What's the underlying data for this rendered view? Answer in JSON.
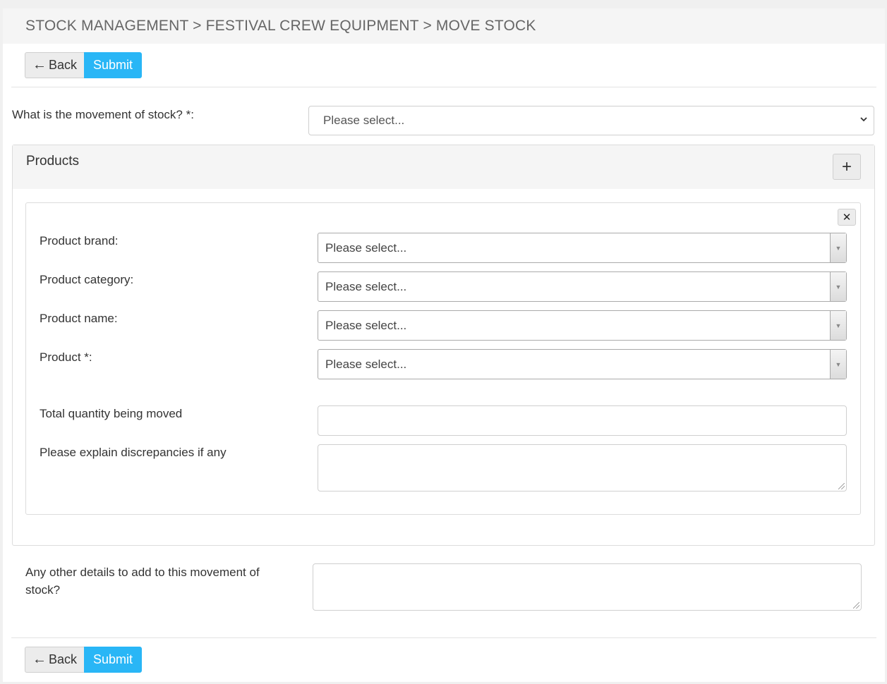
{
  "breadcrumb": "STOCK MANAGEMENT > FESTIVAL CREW EQUIPMENT > MOVE STOCK",
  "buttons": {
    "back_label": "Back",
    "submit_label": "Submit"
  },
  "movement": {
    "label": "What is the movement of stock? *:",
    "selected": "Please select..."
  },
  "products_panel": {
    "title": "Products",
    "add_icon": "+",
    "remove_icon": "✕",
    "fields": {
      "brand": {
        "label": "Product brand:",
        "value": "Please select..."
      },
      "category": {
        "label": "Product category:",
        "value": "Please select..."
      },
      "name": {
        "label": "Product name:",
        "value": "Please select..."
      },
      "product": {
        "label": "Product *:",
        "value": "Please select..."
      },
      "quantity": {
        "label": "Total quantity being moved",
        "value": ""
      },
      "discrepancies": {
        "label": "Please explain discrepancies if any",
        "value": ""
      }
    }
  },
  "other_details": {
    "label": "Any other details to add to this movement of stock?",
    "value": ""
  },
  "colors": {
    "accent": "#29b6f6",
    "header_bg": "#f5f5f5"
  }
}
